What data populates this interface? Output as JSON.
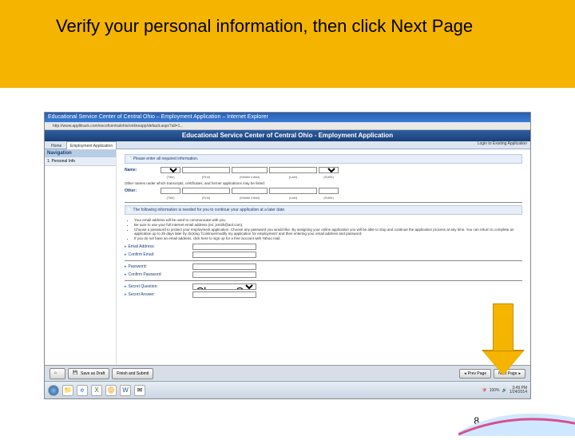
{
  "banner": {
    "title": "Verify your personal information, then click Next Page"
  },
  "browser": {
    "title": "Educational Service Center of Central Ohio – Employment Application – Internet Explorer",
    "url": "http://www.applitrack.com/escofcentralohio/onlineapp/default.aspx?all=1..."
  },
  "app": {
    "header": "Educational Service Center of Central Ohio - Employment Application",
    "tabs": {
      "home": "Home",
      "active": "Employment Application",
      "login": "Login to Existing Application"
    },
    "sidebar": {
      "header": "Navigation",
      "item1": "1. Personal Info"
    },
    "infobar1": "Please enter all required information.",
    "name": {
      "label": "Name:",
      "title": "(Title)",
      "first": "(First)",
      "middle": "(Middle Initial)",
      "last": "(Last)",
      "suffix": "(Suffix)"
    },
    "othernote": "Other names under which transcripts, certificates, and former applications may be listed:",
    "other": {
      "label": "Other:"
    },
    "infobar2": "The following information is needed for you to continue your application at a later date.",
    "bullets": [
      "Your email address will be used to communicate with you.",
      "Be sure to use your full internet email address (ex: jsmith@aol.com).",
      "Choose a password to protect your employment application. Choose any password you would like. By assigning your online application you will be able to stop and continue the application process at any time. You can return to complete an application up to 25 days later by clicking 'Continue/modify my application for employment' and then entering your email address and password.",
      "If you do not have an email address, click here to sign up for a free account with Yahoo mail."
    ],
    "fields": {
      "email": "Email Address:",
      "confirmEmail": "Confirm Email:",
      "password": "Password:",
      "confirmPassword": "Confirm Password:",
      "secretQ": "Secret Question:",
      "secretQval": "Choose One",
      "secretA": "Secret Answer:"
    },
    "buttons": {
      "saveDraft": "Save as Draft",
      "finishSubmit": "Finish and Submit",
      "prev": "Prev Page",
      "next": "Next Page"
    }
  },
  "taskbar": {
    "time": "3:49 PM",
    "date": "1/24/2014"
  },
  "page": {
    "number": "8"
  }
}
